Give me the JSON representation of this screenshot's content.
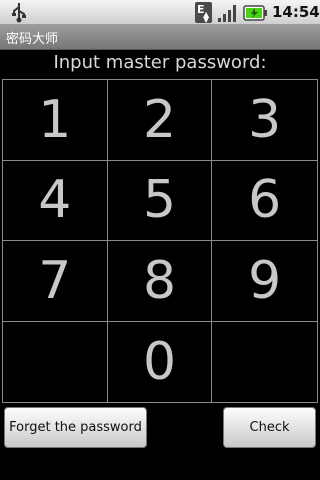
{
  "status_bar": {
    "network_type": "E",
    "time": "14:54",
    "icons": [
      "usb-icon",
      "network-icon",
      "signal-icon",
      "battery-icon"
    ]
  },
  "app": {
    "title": "密码大师"
  },
  "prompt": "Input master password:",
  "keypad": {
    "keys": [
      "1",
      "2",
      "3",
      "4",
      "5",
      "6",
      "7",
      "8",
      "9",
      "",
      "0",
      ""
    ]
  },
  "buttons": {
    "forget_label": "Forget the password",
    "check_label": "Check"
  }
}
